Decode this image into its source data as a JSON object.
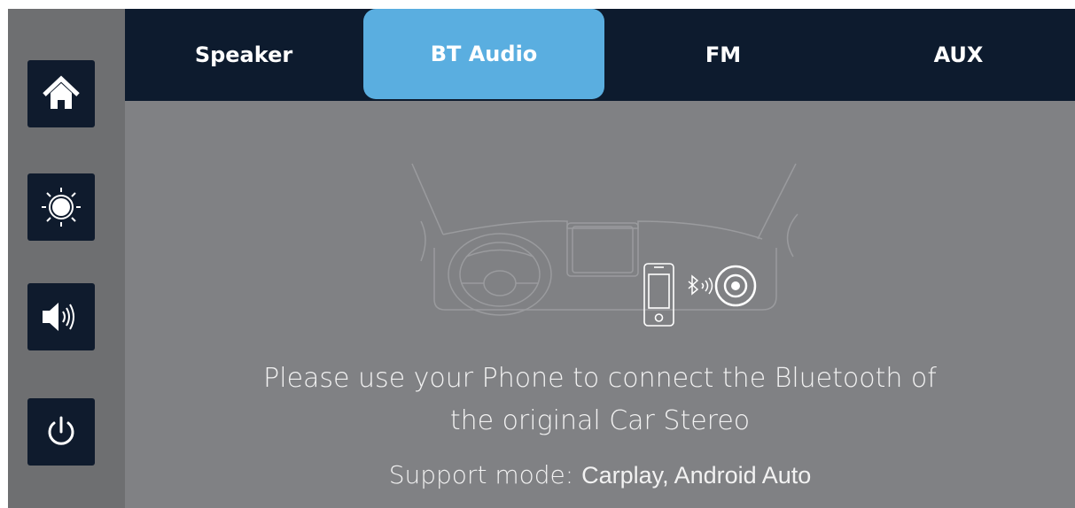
{
  "tabs": [
    {
      "label": "Speaker",
      "active": false
    },
    {
      "label": "BT Audio",
      "active": true
    },
    {
      "label": "FM",
      "active": false
    },
    {
      "label": "AUX",
      "active": false
    }
  ],
  "sidebar": {
    "buttons": [
      {
        "icon": "home-icon"
      },
      {
        "icon": "brightness-icon"
      },
      {
        "icon": "volume-icon"
      },
      {
        "icon": "power-icon"
      }
    ]
  },
  "message": {
    "line1": "Please use your Phone to connect the Bluetooth of",
    "line2": "the original Car Stereo",
    "support_label": "Support mode:",
    "support_modes": "Carplay, Android Auto"
  },
  "colors": {
    "tab_bar": "#0d1b2e",
    "active_tab": "#5aaee0",
    "sidebar": "#6e6f71",
    "main_bg": "#808184",
    "sidebar_button": "#0f1b2d"
  }
}
